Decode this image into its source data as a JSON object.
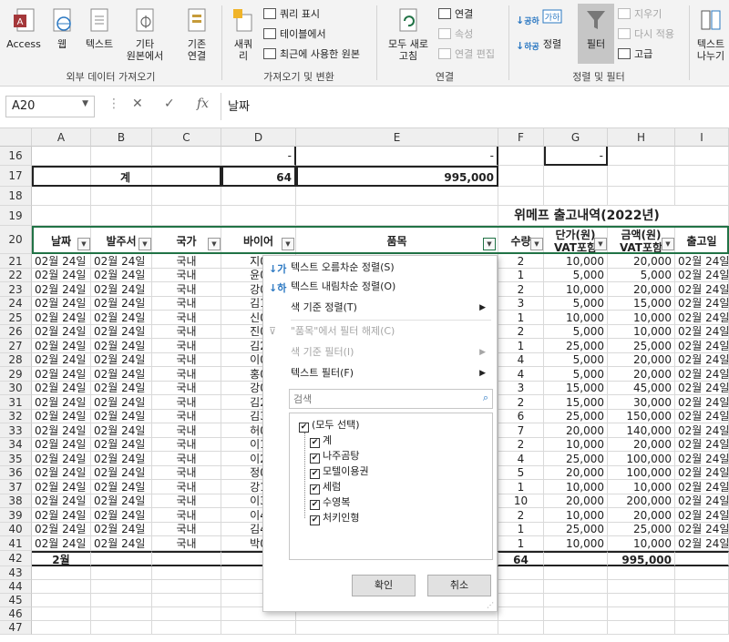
{
  "ribbon": {
    "access": "Access",
    "web": "웹",
    "text": "텍스트",
    "other": "기타",
    "other2": "원본에서",
    "existing": "기존",
    "existing2": "연결",
    "new_query": "새쿼",
    "new_query2": "리",
    "show_query": "쿼리 표시",
    "from_table": "테이블에서",
    "recent_sources": "최근에 사용한 원본",
    "refresh_all": "모두 새로",
    "refresh_all2": "고침",
    "connections": "연결",
    "properties": "속성",
    "edit_links": "연결 편집",
    "sort": "정렬",
    "filter": "필터",
    "clear": "지우기",
    "reapply": "다시 적용",
    "advanced": "고급",
    "text_to_cols": "텍스트",
    "text_to_cols2": "나누기",
    "sort_az": "공하",
    "sort_za": "하공",
    "group_external": "외부 데이터 가져오기",
    "group_transform": "가져오기 및 변환",
    "group_connections": "연결",
    "group_sort_filter": "정렬 및 필터"
  },
  "formula_bar": {
    "name_box": "A20",
    "cancel": "✕",
    "enter": "✓",
    "fx": "fx",
    "content": "날짜"
  },
  "columns": [
    "A",
    "B",
    "C",
    "D",
    "E",
    "F",
    "G",
    "H",
    "I"
  ],
  "rows": {
    "r16": {
      "num": "16",
      "d": "-",
      "e": "-",
      "g": "-"
    },
    "r17": {
      "num": "17",
      "b": "계",
      "d": "64",
      "e": "995,000"
    },
    "r18": {
      "num": "18"
    },
    "r19": {
      "num": "19",
      "title": "위메프 출고내역(2022년)"
    },
    "r20": {
      "num": "20",
      "a": "날짜",
      "b": "발주서",
      "c": "국가",
      "d": "바이어",
      "e": "품목",
      "f": "수량",
      "g1": "단가(원)",
      "g2": "VAT포함",
      "h1": "금액(원)",
      "h2": "VAT포함",
      "i": "출고일"
    }
  },
  "data_rows": [
    {
      "num": "21",
      "a": "02월 24일",
      "b": "02월 24일",
      "c": "국내",
      "d": "지0",
      "f": "2",
      "g": "10,000",
      "h": "20,000",
      "i": "02월 24일"
    },
    {
      "num": "22",
      "a": "02월 24일",
      "b": "02월 24일",
      "c": "국내",
      "d": "윤0",
      "f": "1",
      "g": "5,000",
      "h": "5,000",
      "i": "02월 24일"
    },
    {
      "num": "23",
      "a": "02월 24일",
      "b": "02월 24일",
      "c": "국내",
      "d": "강0",
      "f": "2",
      "g": "10,000",
      "h": "20,000",
      "i": "02월 24일"
    },
    {
      "num": "24",
      "a": "02월 24일",
      "b": "02월 24일",
      "c": "국내",
      "d": "김1",
      "f": "3",
      "g": "5,000",
      "h": "15,000",
      "i": "02월 24일"
    },
    {
      "num": "25",
      "a": "02월 24일",
      "b": "02월 24일",
      "c": "국내",
      "d": "신0",
      "f": "1",
      "g": "10,000",
      "h": "10,000",
      "i": "02월 24일"
    },
    {
      "num": "26",
      "a": "02월 24일",
      "b": "02월 24일",
      "c": "국내",
      "d": "진0",
      "f": "2",
      "g": "5,000",
      "h": "10,000",
      "i": "02월 24일"
    },
    {
      "num": "27",
      "a": "02월 24일",
      "b": "02월 24일",
      "c": "국내",
      "d": "김2",
      "f": "1",
      "g": "25,000",
      "h": "25,000",
      "i": "02월 24일"
    },
    {
      "num": "28",
      "a": "02월 24일",
      "b": "02월 24일",
      "c": "국내",
      "d": "이0",
      "f": "4",
      "g": "5,000",
      "h": "20,000",
      "i": "02월 24일"
    },
    {
      "num": "29",
      "a": "02월 24일",
      "b": "02월 24일",
      "c": "국내",
      "d": "홍0",
      "f": "4",
      "g": "5,000",
      "h": "20,000",
      "i": "02월 24일"
    },
    {
      "num": "30",
      "a": "02월 24일",
      "b": "02월 24일",
      "c": "국내",
      "d": "강0",
      "f": "3",
      "g": "15,000",
      "h": "45,000",
      "i": "02월 24일"
    },
    {
      "num": "31",
      "a": "02월 24일",
      "b": "02월 24일",
      "c": "국내",
      "d": "김2",
      "f": "2",
      "g": "15,000",
      "h": "30,000",
      "i": "02월 24일"
    },
    {
      "num": "32",
      "a": "02월 24일",
      "b": "02월 24일",
      "c": "국내",
      "d": "김3",
      "f": "6",
      "g": "25,000",
      "h": "150,000",
      "i": "02월 24일"
    },
    {
      "num": "33",
      "a": "02월 24일",
      "b": "02월 24일",
      "c": "국내",
      "d": "허0",
      "f": "7",
      "g": "20,000",
      "h": "140,000",
      "i": "02월 24일"
    },
    {
      "num": "34",
      "a": "02월 24일",
      "b": "02월 24일",
      "c": "국내",
      "d": "이1",
      "f": "2",
      "g": "10,000",
      "h": "20,000",
      "i": "02월 24일"
    },
    {
      "num": "35",
      "a": "02월 24일",
      "b": "02월 24일",
      "c": "국내",
      "d": "이2",
      "f": "4",
      "g": "25,000",
      "h": "100,000",
      "i": "02월 24일"
    },
    {
      "num": "36",
      "a": "02월 24일",
      "b": "02월 24일",
      "c": "국내",
      "d": "정0",
      "f": "5",
      "g": "20,000",
      "h": "100,000",
      "i": "02월 24일"
    },
    {
      "num": "37",
      "a": "02월 24일",
      "b": "02월 24일",
      "c": "국내",
      "d": "강1",
      "f": "1",
      "g": "10,000",
      "h": "10,000",
      "i": "02월 24일"
    },
    {
      "num": "38",
      "a": "02월 24일",
      "b": "02월 24일",
      "c": "국내",
      "d": "이3",
      "f": "10",
      "g": "20,000",
      "h": "200,000",
      "i": "02월 24일"
    },
    {
      "num": "39",
      "a": "02월 24일",
      "b": "02월 24일",
      "c": "국내",
      "d": "이4",
      "f": "2",
      "g": "10,000",
      "h": "20,000",
      "i": "02월 24일"
    },
    {
      "num": "40",
      "a": "02월 24일",
      "b": "02월 24일",
      "c": "국내",
      "d": "김4",
      "f": "1",
      "g": "25,000",
      "h": "25,000",
      "i": "02월 24일"
    },
    {
      "num": "41",
      "a": "02월 24일",
      "b": "02월 24일",
      "c": "국내",
      "d": "박0",
      "f": "1",
      "g": "10,000",
      "h": "10,000",
      "i": "02월 24일"
    }
  ],
  "row42": {
    "num": "42",
    "a": "2월",
    "f": "64",
    "h": "995,000"
  },
  "empty_rows": [
    "43",
    "44",
    "45",
    "46",
    "47"
  ],
  "menu": {
    "sort_asc": "텍스트 오름차순 정렬(S)",
    "sort_desc": "텍스트 내림차순 정렬(O)",
    "sort_color": "색 기준 정렬(T)",
    "clear_filter": "\"품목\"에서 필터 해제(C)",
    "filter_color": "색 기준 필터(I)",
    "text_filter": "텍스트 필터(F)",
    "search_placeholder": "검색",
    "items": [
      "(모두 선택)",
      "계",
      "나주곰탕",
      "모텔이용권",
      "세럼",
      "수영복",
      "처키인형"
    ],
    "ok": "확인",
    "cancel": "취소"
  },
  "colors": {
    "excel_green": "#217346",
    "selection_border": "#217346"
  }
}
